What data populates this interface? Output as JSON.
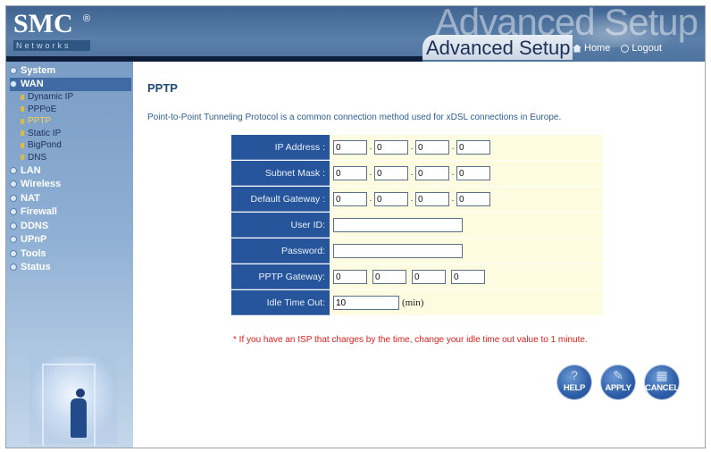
{
  "header": {
    "brand": "SMC",
    "brand_mark": "®",
    "brand_sub": "Networks",
    "watermark": "Advanced Setup",
    "title": "Advanced Setup",
    "home_label": "Home",
    "logout_label": "Logout"
  },
  "sidebar": {
    "menu": [
      {
        "label": "System"
      },
      {
        "label": "WAN",
        "active": true
      },
      {
        "label": "LAN"
      },
      {
        "label": "Wireless"
      },
      {
        "label": "NAT"
      },
      {
        "label": "Firewall"
      },
      {
        "label": "DDNS"
      },
      {
        "label": "UPnP"
      },
      {
        "label": "Tools"
      },
      {
        "label": "Status"
      }
    ],
    "wan_submenu": [
      {
        "label": "Dynamic IP"
      },
      {
        "label": "PPPoE"
      },
      {
        "label": "PPTP",
        "active": true
      },
      {
        "label": "Static IP"
      },
      {
        "label": "BigPond"
      },
      {
        "label": "DNS"
      }
    ]
  },
  "main": {
    "title": "PPTP",
    "description": "Point-to-Point Tunneling Protocol is a common connection method used for xDSL connections in Europe.",
    "form": {
      "ip_address": {
        "label": "IP Address :",
        "octets": [
          "0",
          "0",
          "0",
          "0"
        ],
        "separator": "."
      },
      "subnet_mask": {
        "label": "Subnet Mask :",
        "octets": [
          "0",
          "0",
          "0",
          "0"
        ],
        "separator": "."
      },
      "default_gateway": {
        "label": "Default Gateway :",
        "octets": [
          "0",
          "0",
          "0",
          "0"
        ],
        "separator": "."
      },
      "user_id": {
        "label": "User ID:",
        "value": ""
      },
      "password": {
        "label": "Password:",
        "value": ""
      },
      "pptp_gateway": {
        "label": "PPTP Gateway:",
        "octets": [
          "0",
          "0",
          "0",
          "0"
        ]
      },
      "idle_time_out": {
        "label": "Idle Time Out:",
        "value": "10",
        "unit": "(min)"
      }
    },
    "note": "* If you have an ISP that charges by the time, change your idle time out value to 1 minute.",
    "buttons": {
      "help": "HELP",
      "apply": "APPLY",
      "cancel": "CANCEL"
    }
  },
  "colors": {
    "header_bg": "#4e739e",
    "label_bg": "#26559c",
    "field_bg": "#fdfbe0",
    "note": "#e0201e",
    "active_sub": "#f4d25a"
  }
}
